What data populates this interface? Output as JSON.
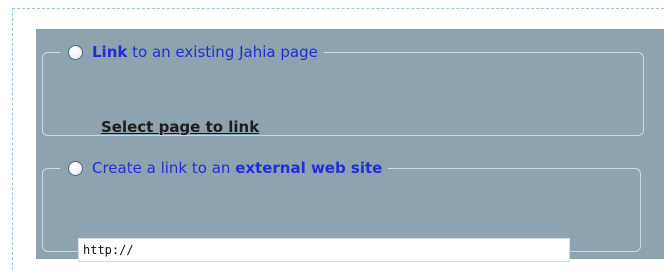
{
  "internal_link": {
    "legend_strong": "Link",
    "legend_rest": "to an existing Jahia page",
    "select_label": "Select page to link"
  },
  "external_link": {
    "legend_prefix": "Create a link to an",
    "legend_strong": "external web site",
    "url_value": "http://"
  },
  "colors": {
    "panel_bg": "#8ea3b0",
    "legend_text": "#1f2fd6",
    "dash_border": "#9fc3dd"
  }
}
